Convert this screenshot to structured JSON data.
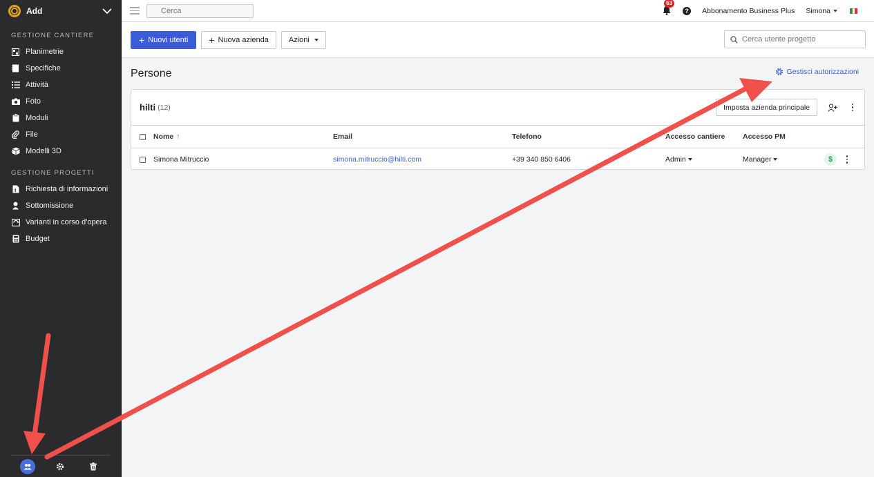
{
  "sidebar": {
    "project": "Add",
    "section_site": "GESTIONE CANTIERE",
    "site_items": [
      {
        "label": "Planimetrie",
        "icon": "floorplan-icon"
      },
      {
        "label": "Specifiche",
        "icon": "specs-icon"
      },
      {
        "label": "Attività",
        "icon": "tasks-icon"
      },
      {
        "label": "Foto",
        "icon": "camera-icon"
      },
      {
        "label": "Moduli",
        "icon": "clipboard-icon"
      },
      {
        "label": "File",
        "icon": "paperclip-icon"
      },
      {
        "label": "Modelli 3D",
        "icon": "cube-icon"
      }
    ],
    "section_projects": "GESTIONE PROGETTI",
    "project_items": [
      {
        "label": "Richiesta di informazioni",
        "icon": "rfi-icon"
      },
      {
        "label": "Sottomissione",
        "icon": "submittal-icon"
      },
      {
        "label": "Varianti in corso d'opera",
        "icon": "change-order-icon"
      },
      {
        "label": "Budget",
        "icon": "calculator-icon"
      }
    ]
  },
  "topbar": {
    "search_placeholder": "Cerca",
    "notifications": "63",
    "help": "?",
    "subscription": "Abbonamento Business Plus",
    "user": "Simona"
  },
  "actions": {
    "new_users": "Nuovi utenti",
    "new_company": "Nuova azienda",
    "actions": "Azioni",
    "search_placeholder": "Cerca utente progetto"
  },
  "main": {
    "title": "Persone",
    "manage_permissions": "Gestisci autorizzazioni",
    "company": "hilti",
    "count": "(12)",
    "set_main": "Imposta azienda principale",
    "columns": {
      "name": "Nome",
      "email": "Email",
      "phone": "Telefono",
      "site_access": "Accesso cantiere",
      "pm_access": "Accesso PM"
    },
    "rows": [
      {
        "name": "Simona Mitruccio",
        "email": "simona.mitruccio@hilti.com",
        "phone": "+39 340 850 6406",
        "site_access": "Admin",
        "pm_access": "Manager",
        "billing": "$"
      }
    ]
  },
  "colors": {
    "accent": "#3b5bdb",
    "annotation_arrow": "#f0504a",
    "sidebar_bg": "#2b2b2d"
  }
}
